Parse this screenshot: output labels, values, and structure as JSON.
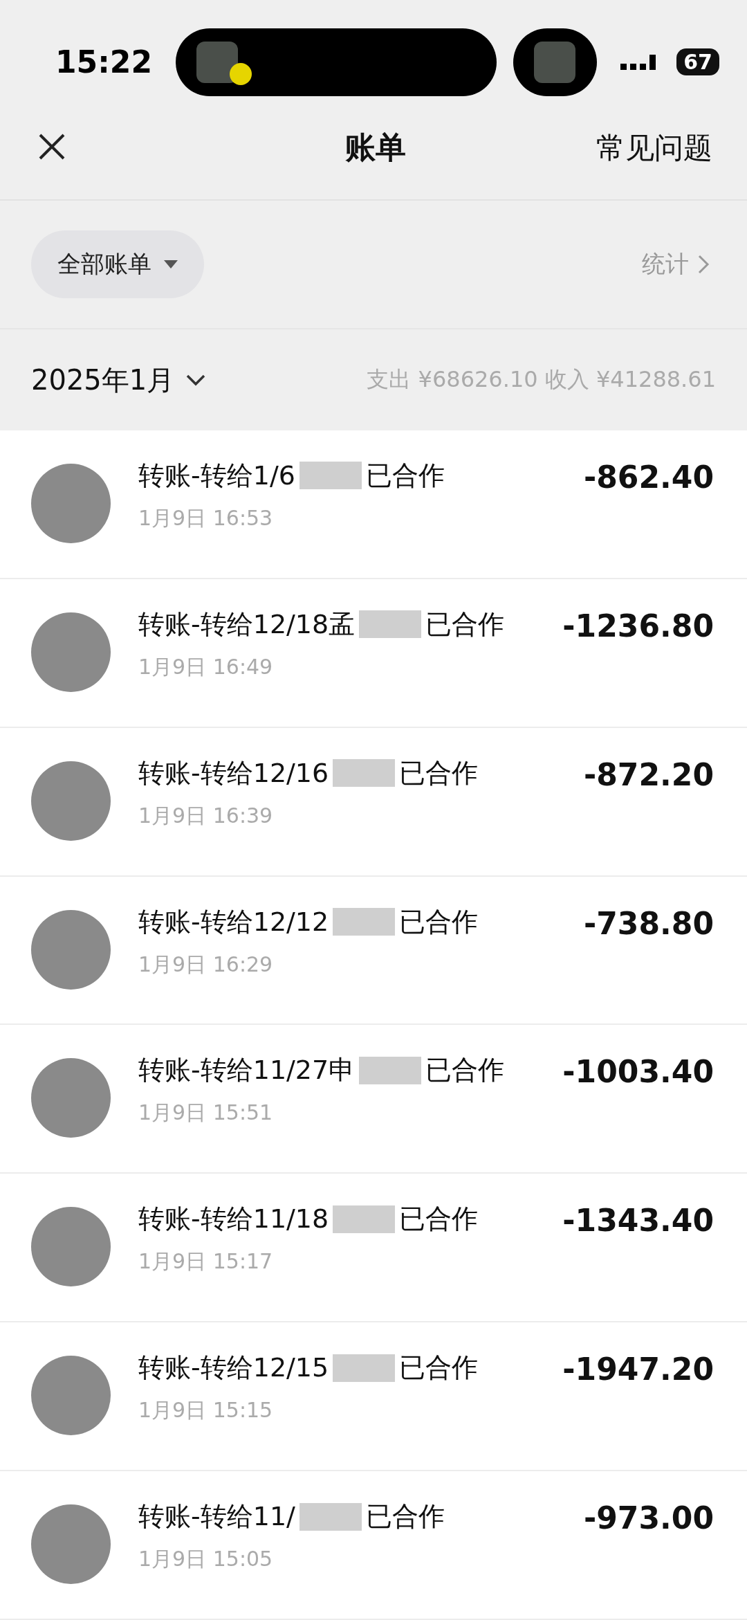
{
  "status_bar": {
    "time": "15:22",
    "battery": "67"
  },
  "nav": {
    "title": "账单",
    "action": "常见问题"
  },
  "filter": {
    "label": "全部账单",
    "stats": "统计"
  },
  "month": {
    "label": "2025年1月",
    "summary": "支出 ¥68626.10 收入 ¥41288.61"
  },
  "rows": [
    {
      "title_start": "转账-转给1/6",
      "title_end": "已合作",
      "time": "1月9日 16:53",
      "amount": "-862.40"
    },
    {
      "title_start": "转账-转给12/18孟",
      "title_end": "已合作",
      "time": "1月9日 16:49",
      "amount": "-1236.80"
    },
    {
      "title_start": "转账-转给12/16",
      "title_end": "已合作",
      "time": "1月9日 16:39",
      "amount": "-872.20"
    },
    {
      "title_start": "转账-转给12/12",
      "title_end": "已合作",
      "time": "1月9日 16:29",
      "amount": "-738.80"
    },
    {
      "title_start": "转账-转给11/27申",
      "title_end": "已合作",
      "time": "1月9日 15:51",
      "amount": "-1003.40"
    },
    {
      "title_start": "转账-转给11/18",
      "title_end": "已合作",
      "time": "1月9日 15:17",
      "amount": "-1343.40"
    },
    {
      "title_start": "转账-转给12/15",
      "title_end": "已合作",
      "time": "1月9日 15:15",
      "amount": "-1947.20"
    },
    {
      "title_start": "转账-转给11/",
      "title_end": "已合作",
      "time": "1月9日 15:05",
      "amount": "-973.00"
    }
  ]
}
